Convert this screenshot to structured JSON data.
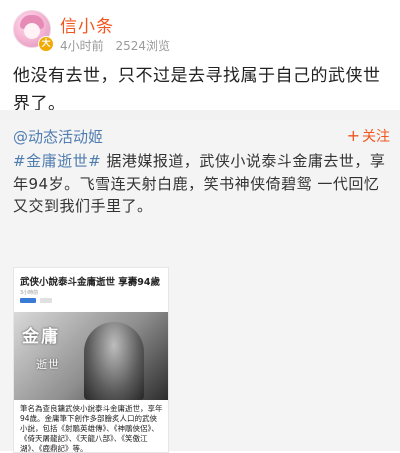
{
  "post": {
    "author": "信小条",
    "time": "4小时前",
    "views": "2524浏览",
    "text": "他没有去世，只不过是去寻找属于自己的武侠世界了。",
    "badge": "大"
  },
  "repost": {
    "author": "@动态活动姬",
    "follow_label": "关注",
    "hashtag": "#金庸逝世#",
    "text_after_hashtag": " 据港媒报道，武侠小说泰斗金庸去世，享年94岁。飞雪连天射白鹿，笑书神侠倚碧鸳 一代回忆又交到我们手里了。"
  },
  "news_image": {
    "title": "武侠小說泰斗金庸逝世 享壽94歲",
    "sub": "3小時前",
    "calligraphy_1": "金庸",
    "calligraphy_2": "逝世",
    "caption": "筆名為查良鏞武俠小說泰斗金庸逝世，享年94歲。金庸筆下創作多部膾炙人口的武俠小說，包括《射鵰英雄傳》、《神鵰俠侶》、《倚天屠龍記》、《天龍八部》、《笑傲江湖》、《鹿鼎記》等。"
  },
  "colors": {
    "author_orange": "#f2551f",
    "link_blue": "#507daf",
    "repost_bg": "#f4f4f4",
    "badge_yellow": "#f2a900"
  }
}
